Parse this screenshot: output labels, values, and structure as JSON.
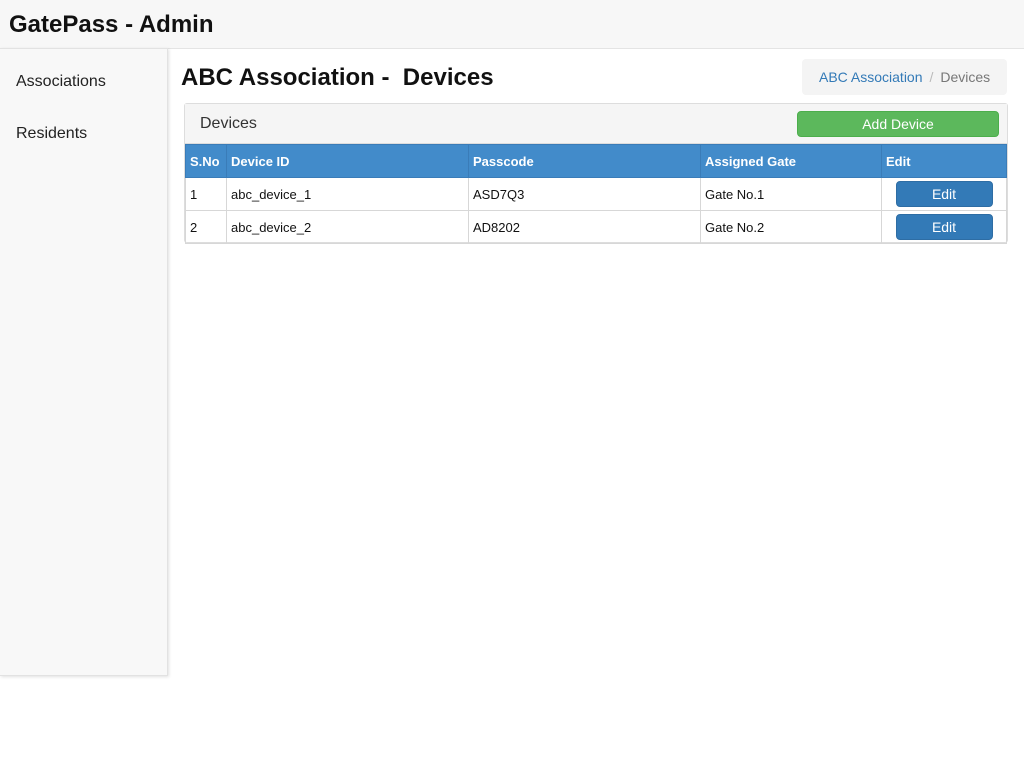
{
  "app": {
    "title": "GatePass - Admin"
  },
  "sidebar": {
    "items": [
      {
        "label": "Associations"
      },
      {
        "label": "Residents"
      }
    ]
  },
  "page": {
    "title": "ABC Association -  Devices"
  },
  "breadcrumb": {
    "link": "ABC Association",
    "separator": "/",
    "current": "Devices"
  },
  "panel": {
    "title": "Devices",
    "add_button": "Add Device"
  },
  "table": {
    "headers": [
      "S.No",
      "Device ID",
      "Passcode",
      "Assigned Gate",
      "Edit"
    ],
    "rows": [
      {
        "sno": "1",
        "device_id": "abc_device_1",
        "passcode": "ASD7Q3",
        "gate": "Gate No.1",
        "edit": "Edit"
      },
      {
        "sno": "2",
        "device_id": "abc_device_2",
        "passcode": "AD8202",
        "gate": "Gate No.2",
        "edit": "Edit"
      }
    ]
  },
  "colors": {
    "table_header": "#428bca",
    "add_button": "#5cb85c",
    "edit_button": "#337ab7",
    "breadcrumb_link": "#337ab7"
  }
}
